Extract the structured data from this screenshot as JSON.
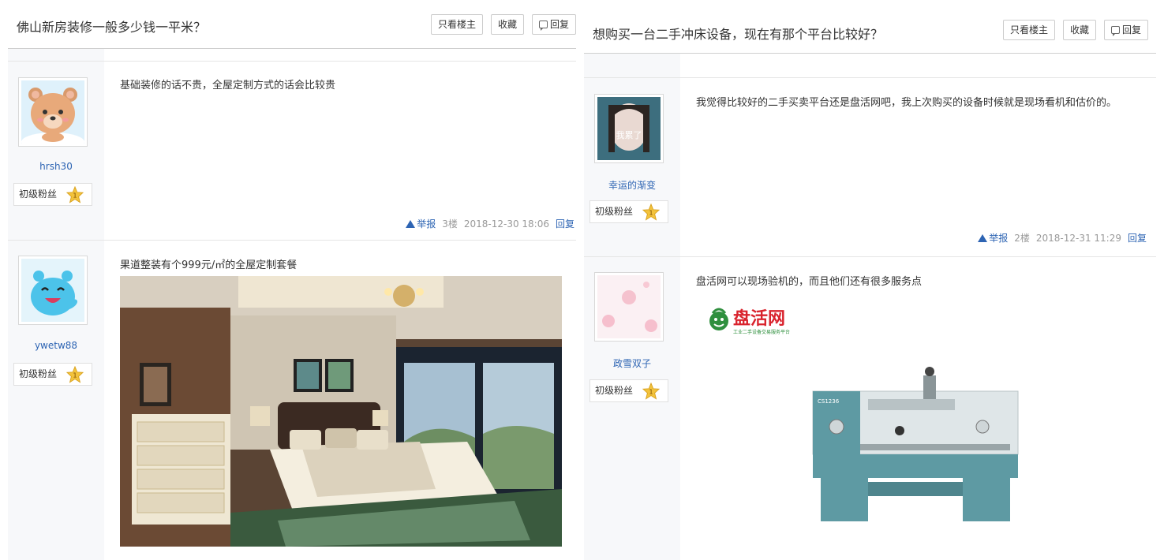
{
  "buttons": {
    "only_op": "只看楼主",
    "favorite": "收藏",
    "reply": "回复"
  },
  "left": {
    "title": "佛山新房装修一般多少钱一平米？",
    "posts": [
      {
        "user": "hrsh30",
        "level": "初级粉丝",
        "level_num": "1",
        "text": "基础装修的话不贵，全屋定制方式的话会比较贵",
        "report": "举报",
        "floor": "3楼",
        "time": "2018-12-30 18:06",
        "reply": "回复"
      },
      {
        "user": "ywetw88",
        "level": "初级粉丝",
        "level_num": "1",
        "text": "果道整装有个999元/㎡的全屋定制套餐"
      }
    ]
  },
  "right": {
    "title": "想购买一台二手冲床设备，现在有那个平台比较好？",
    "posts": [
      {
        "user": "幸运的渐变",
        "level": "初级粉丝",
        "level_num": "1",
        "avatar_text": "我累了",
        "text": "我觉得比较好的二手买卖平台还是盘活网吧，我上次购买的设备时候就是现场看机和估价的。",
        "report": "举报",
        "floor": "2楼",
        "time": "2018-12-31 11:29",
        "reply": "回复"
      },
      {
        "user": "政雪双子",
        "level": "初级粉丝",
        "level_num": "1",
        "text": "盘活网可以现场验机的，而且他们还有很多服务点",
        "logo_text": "盘活网",
        "logo_sub": "工业二手设备交易服务平台",
        "machine_label": "CS1236"
      }
    ]
  },
  "colors": {
    "link": "#2d64b3",
    "sidebar": "#f7f8fa",
    "star": "#f3c33c",
    "machine": "#5e9aa3"
  }
}
